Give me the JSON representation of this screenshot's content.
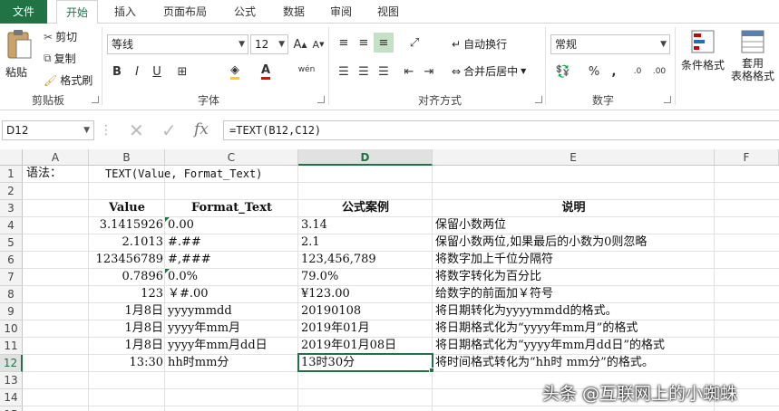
{
  "ribbon_tabs": [
    "文件",
    "开始",
    "插入",
    "页面布局",
    "公式",
    "数据",
    "审阅",
    "视图"
  ],
  "clipboard": {
    "paste": "粘贴",
    "cut": "剪切",
    "copy": "复制",
    "format_painter": "格式刷",
    "group": "剪贴板"
  },
  "font": {
    "name": "等线",
    "size": "12",
    "bold": "B",
    "italic": "I",
    "underline": "U",
    "wen": "wén",
    "group": "字体"
  },
  "alignment": {
    "wrap": "自动换行",
    "merge": "合并后居中",
    "group": "对齐方式"
  },
  "number": {
    "format": "常规",
    "percent": "%",
    "comma": ",",
    "group": "数字"
  },
  "styles": {
    "conditional": "条件格式",
    "table_format_1": "套用",
    "table_format_2": "表格格式"
  },
  "formula_bar": {
    "name_box": "D12",
    "fx": "fx",
    "formula": "=TEXT(B12,C12)"
  },
  "columns": [
    "A",
    "B",
    "C",
    "D",
    "E",
    "F"
  ],
  "rows": [
    "1",
    "2",
    "3",
    "4",
    "5",
    "6",
    "7",
    "8",
    "9",
    "10",
    "11",
    "12",
    "13",
    "14",
    "15"
  ],
  "sheet": {
    "a1": "语法：",
    "b1": "TEXT(Value, Format_Text)",
    "headers": {
      "value": "Value",
      "format_text": "Format_Text",
      "example": "公式案例",
      "note": "说明"
    },
    "data": [
      {
        "value": "3.1415926",
        "format": "0.00",
        "result": "3.14",
        "note": "保留小数两位"
      },
      {
        "value": "2.1013",
        "format": "#.##",
        "result": "2.1",
        "note": "保留小数两位,如果最后的小数为0则忽略"
      },
      {
        "value": "123456789",
        "format": "#,###",
        "result": "123,456,789",
        "note": "将数字加上千位分隔符"
      },
      {
        "value": "0.7896",
        "format": "0.0%",
        "result": "79.0%",
        "note": "将数字转化为百分比"
      },
      {
        "value": "123",
        "format": "￥#.00",
        "result": "¥123.00",
        "note": "给数字的前面加￥符号"
      },
      {
        "value": "1月8日",
        "format": "yyyymmdd",
        "result": "20190108",
        "note": "将日期转化为yyyymmdd的格式。"
      },
      {
        "value": "1月8日",
        "format": "yyyy年mm月",
        "result": "2019年01月",
        "note": "将日期格式化为“yyyy年mm月”的格式"
      },
      {
        "value": "1月8日",
        "format": "yyyy年mm月dd日",
        "result": "2019年01月08日",
        "note": "将日期格式化为“yyyy年mm月dd日”的格式"
      },
      {
        "value": "13:30",
        "format": "hh时mm分",
        "result": "13时30分",
        "note": "将时间格式转化为“hh时 mm分”的格式。"
      }
    ]
  },
  "watermark": "头条 @互联网上的小蜘蛛",
  "colors": {
    "accent": "#217346",
    "grid": "#e2e2e2",
    "header_bg": "#f3f3f3"
  }
}
